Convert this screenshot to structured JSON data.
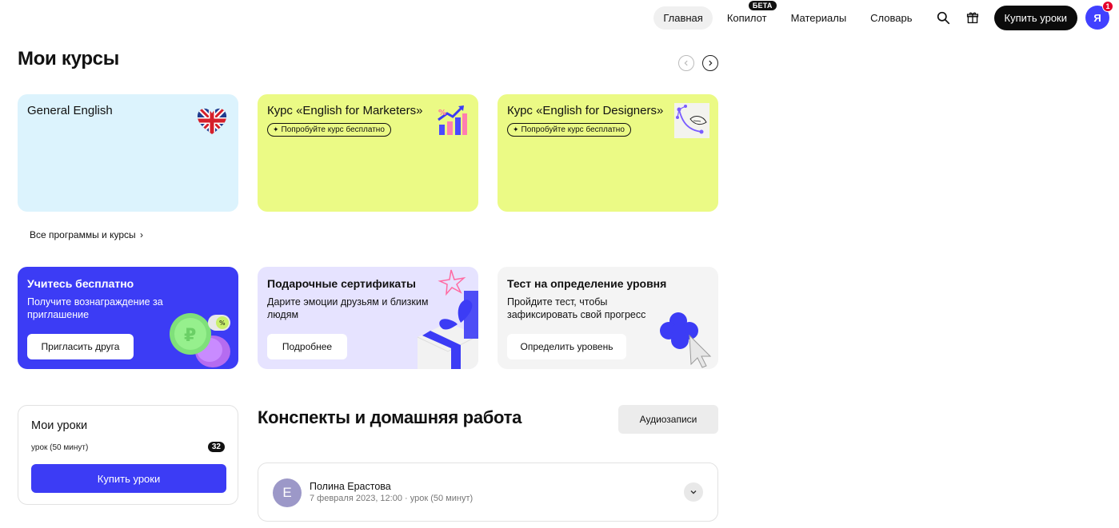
{
  "nav": {
    "items": [
      {
        "label": "Главная",
        "active": true
      },
      {
        "label": "Копилот",
        "badge": "БЕТА"
      },
      {
        "label": "Материалы"
      },
      {
        "label": "Словарь"
      }
    ],
    "buy_label": "Купить уроки",
    "avatar_letter": "Я",
    "avatar_badge": "1"
  },
  "courses": {
    "title": "Мои курсы",
    "cards": [
      {
        "title": "General English",
        "bg": "#dcf3fd"
      },
      {
        "title": "Курс «English for Marketers»",
        "pill": "Попробуйте курс бесплатно",
        "bg": "#ebfa85"
      },
      {
        "title": "Курс «English for Designers»",
        "pill": "Попробуйте курс бесплатно",
        "bg": "#ebfa85"
      }
    ],
    "all_link": "Все программы и курсы"
  },
  "promos": [
    {
      "title": "Учитесь бесплатно",
      "text": "Получите вознаграждение за приглашение",
      "button": "Пригласить друга",
      "bg": "#3c3cf5"
    },
    {
      "title": "Подарочные сертификаты",
      "text": "Дарите эмоции друзьям и близким людям",
      "button": "Подробнее",
      "bg": "#e6e3ff"
    },
    {
      "title": "Тест на определение уровня",
      "text": "Пройдите тест, чтобы зафиксировать свой прогресс",
      "button": "Определить уровень",
      "bg": "#f4f4f4"
    }
  ],
  "lessons": {
    "title": "Мои уроки",
    "subtitle": "урок (50 минут)",
    "count": "32",
    "button": "Купить уроки"
  },
  "notes": {
    "title": "Конспекты и домашняя работа",
    "audio_button": "Аудиозаписи",
    "item": {
      "avatar_letter": "Е",
      "name": "Полина Ерастова",
      "meta": "7 февраля 2023, 12:00 · урок (50 минут)"
    }
  },
  "colors": {
    "accent": "#3c3cf5",
    "lime": "#ebfa85",
    "sky": "#dcf3fd",
    "lavender": "#e6e3ff"
  }
}
